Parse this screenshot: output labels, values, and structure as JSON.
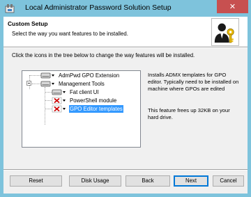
{
  "window": {
    "title": "Local Administrator Password Solution Setup",
    "close_glyph": "✕"
  },
  "header": {
    "title": "Custom Setup",
    "subtitle": "Select the way you want features to be installed."
  },
  "instructions": "Click the icons in the tree below to change the way features will be installed.",
  "tree": {
    "items": [
      {
        "label": "AdmPwd GPO Extension",
        "state": "install",
        "icon": "drive-icon"
      },
      {
        "label": "Management Tools",
        "state": "install",
        "icon": "drive-icon"
      },
      {
        "label": "Fat client UI",
        "state": "install",
        "icon": "drive-icon"
      },
      {
        "label": "PowerShell module",
        "state": "unavailable",
        "icon": "red-x-icon"
      },
      {
        "label": "GPO Editor templates",
        "state": "unavailable",
        "icon": "red-x-icon",
        "selected": true
      }
    ]
  },
  "description": {
    "text": "Installs ADMX templates for GPO editor. Typically need to be installed on machine where GPOs are edited",
    "size_text": "This feature frees up 32KB on your hard drive."
  },
  "buttons": {
    "reset": "Reset",
    "disk_usage": "Disk Usage",
    "back": "Back",
    "next": "Next",
    "cancel": "Cancel"
  },
  "colors": {
    "titlebar": "#7ec3dc",
    "close": "#c75050",
    "selection": "#3399ff",
    "unavailable_x": "#cc0000"
  }
}
